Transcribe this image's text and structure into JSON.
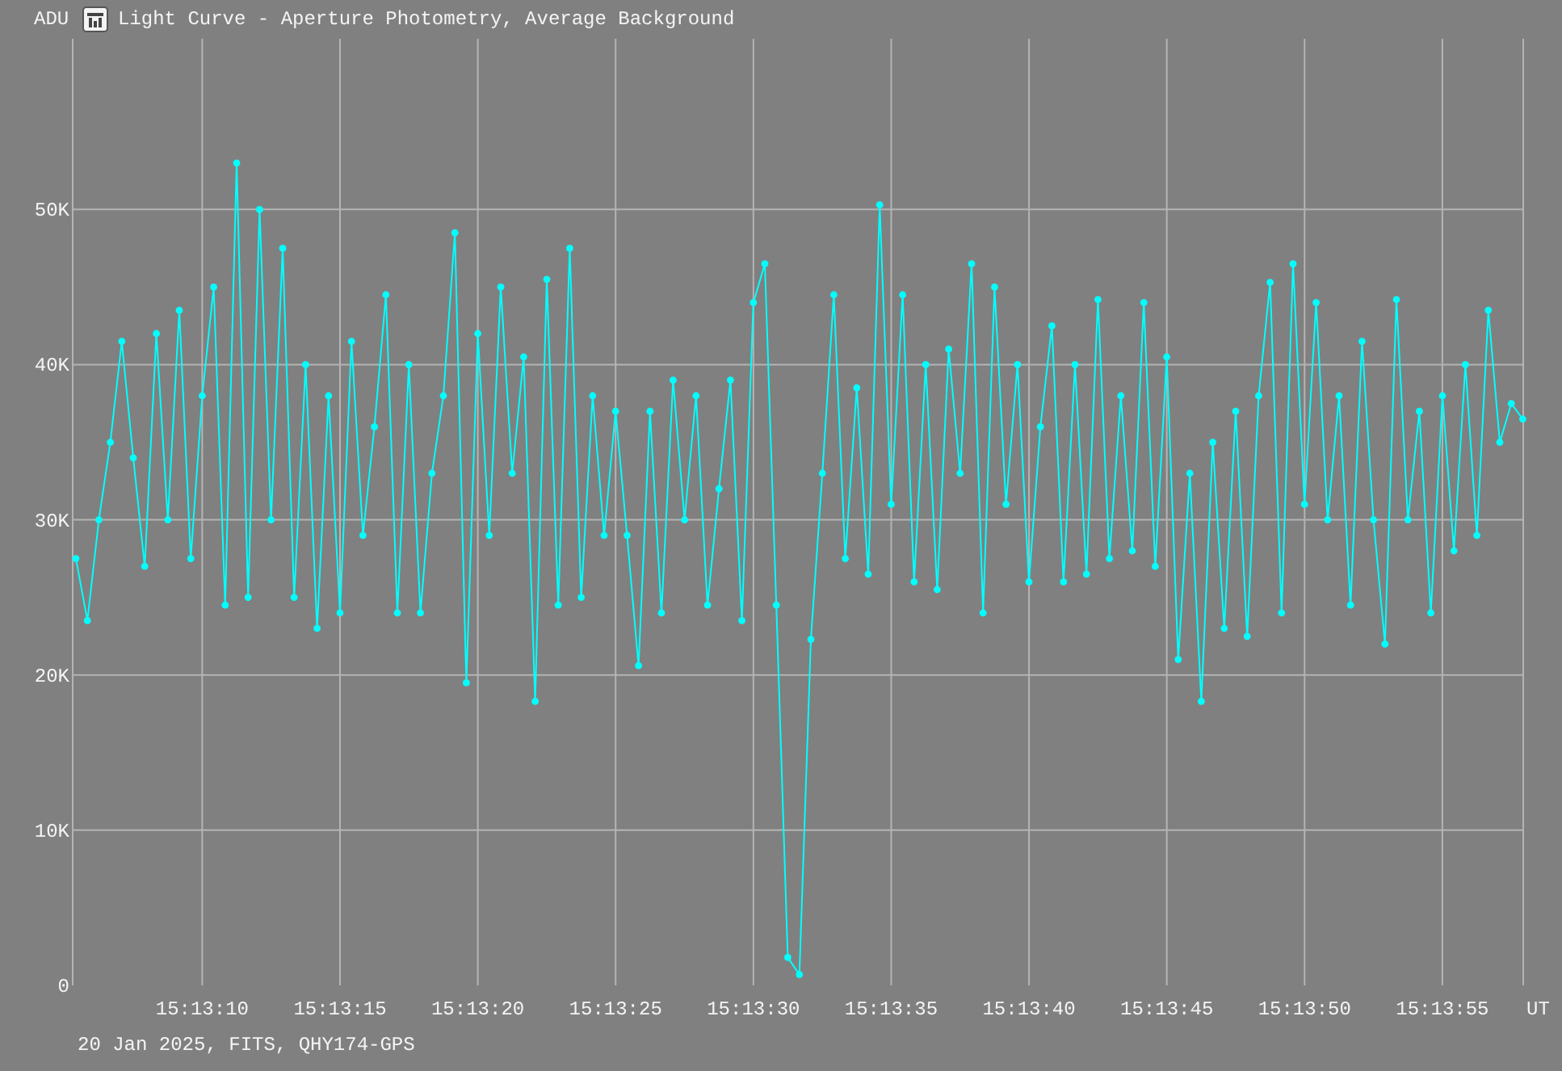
{
  "window": {
    "title": "Light Curve - Aperture Photometry, Average Background"
  },
  "chart": {
    "chart_data": {
      "type": "line",
      "ylabel": "ADU",
      "xlabel": "UT",
      "categories": [
        null,
        null,
        null,
        null,
        null,
        null,
        null,
        null,
        null,
        null,
        null,
        "15:13:10",
        null,
        null,
        null,
        null,
        null,
        null,
        null,
        null,
        null,
        null,
        null,
        "15:13:15",
        null,
        null,
        null,
        null,
        null,
        null,
        null,
        null,
        null,
        null,
        null,
        "15:13:20",
        null,
        null,
        null,
        null,
        null,
        null,
        null,
        null,
        null,
        null,
        null,
        "15:13:25",
        null,
        null,
        null,
        null,
        null,
        null,
        null,
        null,
        null,
        null,
        null,
        "15:13:30",
        null,
        null,
        null,
        null,
        null,
        null,
        null,
        null,
        null,
        null,
        null,
        "15:13:35",
        null,
        null,
        null,
        null,
        null,
        null,
        null,
        null,
        null,
        null,
        null,
        "15:13:40",
        null,
        null,
        null,
        null,
        null,
        null,
        null,
        null,
        null,
        null,
        null,
        "15:13:45",
        null,
        null,
        null,
        null,
        null,
        null,
        null,
        null,
        null,
        null,
        null,
        "15:13:50",
        null,
        null,
        null,
        null,
        null,
        null,
        null,
        null,
        null,
        null,
        null,
        "15:13:55",
        null,
        null,
        null,
        null,
        null,
        null,
        null
      ],
      "series": [
        {
          "color": "#00ffff",
          "marker": "circle",
          "values": [
            27500,
            23500,
            30000,
            35000,
            41500,
            34000,
            27000,
            42000,
            30000,
            43500,
            27500,
            38000,
            45000,
            24500,
            53000,
            25000,
            50000,
            30000,
            47500,
            25000,
            40000,
            23000,
            38000,
            24000,
            41500,
            29000,
            36000,
            44500,
            24000,
            40000,
            24000,
            33000,
            38000,
            48500,
            19500,
            42000,
            29000,
            45000,
            33000,
            40500,
            18300,
            45500,
            24500,
            47500,
            25000,
            38000,
            29000,
            37000,
            29000,
            20600,
            37000,
            24000,
            39000,
            30000,
            38000,
            24500,
            32000,
            39000,
            23500,
            44000,
            46500,
            24500,
            1800,
            700,
            22300,
            33000,
            44500,
            27500,
            38500,
            26500,
            50300,
            31000,
            44500,
            26000,
            40000,
            25500,
            41000,
            33000,
            46500,
            24000,
            45000,
            31000,
            40000,
            26000,
            36000,
            42500,
            26000,
            40000,
            26500,
            44200,
            27500,
            38000,
            28000,
            44000,
            27000,
            40500,
            21000,
            33000,
            18300,
            35000,
            23000,
            37000,
            22500,
            38000,
            45300,
            24000,
            46500,
            31000,
            44000,
            30000,
            38000,
            24500,
            41500,
            30000,
            22000,
            44200,
            30000,
            37000,
            24000,
            38000,
            28000,
            40000,
            29000,
            43500,
            35000,
            37500,
            36500
          ]
        }
      ],
      "grid": true,
      "ylim": [
        0,
        61000
      ],
      "yticks": [
        {
          "value": 0,
          "label": "0"
        },
        {
          "value": 10000,
          "label": "10K"
        },
        {
          "value": 20000,
          "label": "20K"
        },
        {
          "value": 30000,
          "label": "30K"
        },
        {
          "value": 40000,
          "label": "40K"
        },
        {
          "value": 50000,
          "label": "50K"
        }
      ]
    }
  },
  "footer": {
    "text": "20 Jan 2025, FITS, QHY174-GPS"
  }
}
